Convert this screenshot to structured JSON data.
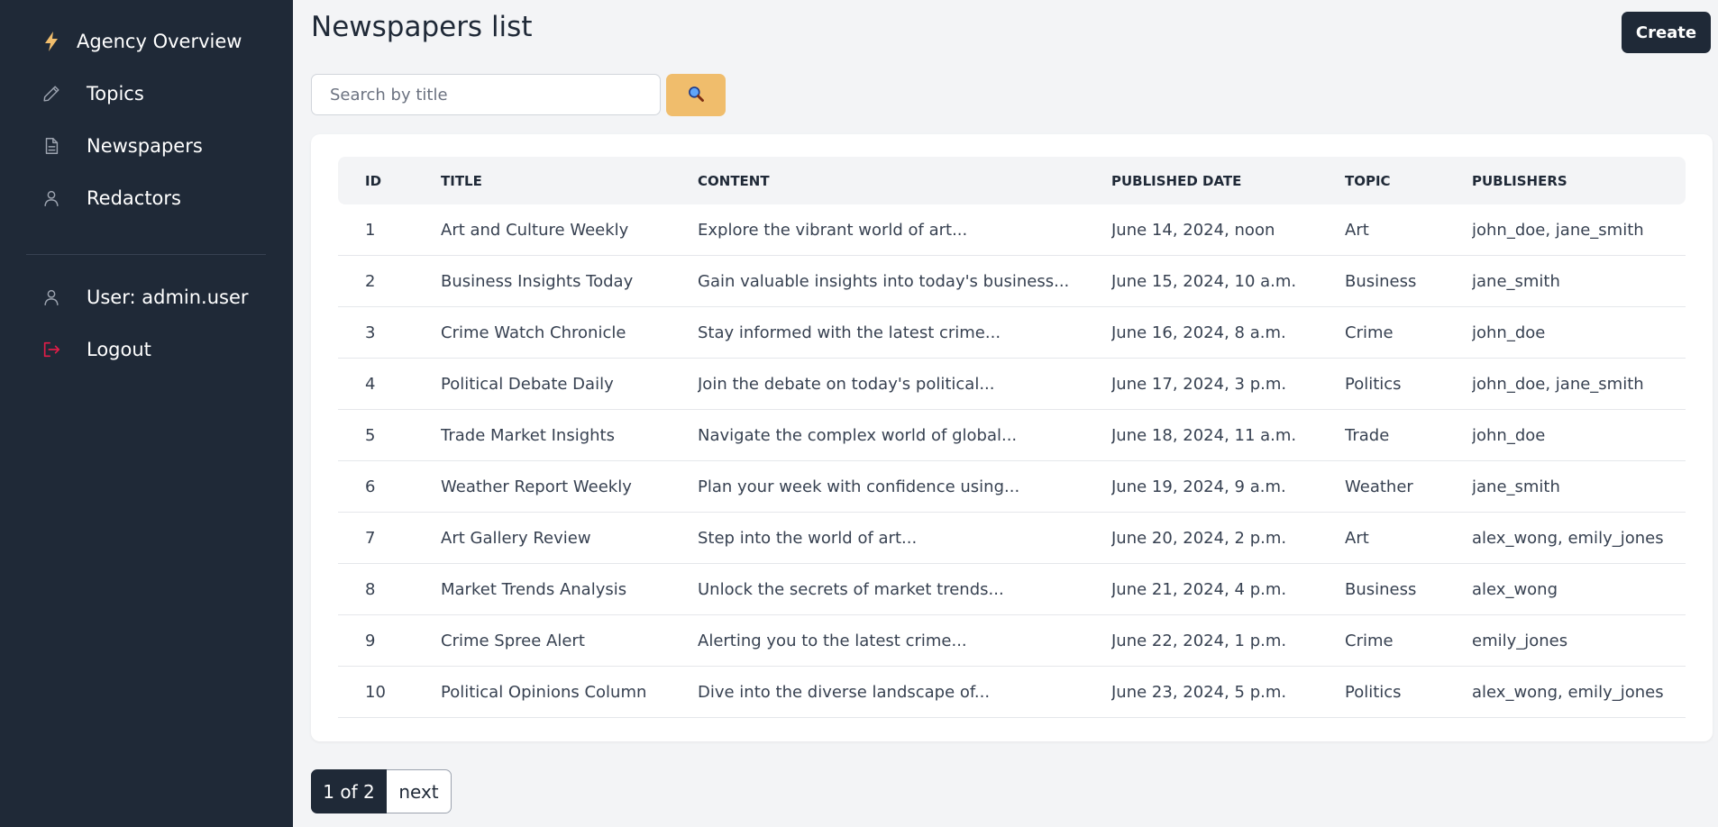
{
  "sidebar": {
    "items": [
      {
        "label": "Agency Overview",
        "icon": "lightning-icon"
      },
      {
        "label": "Topics",
        "icon": "pencil-icon"
      },
      {
        "label": "Newspapers",
        "icon": "document-icon"
      },
      {
        "label": "Redactors",
        "icon": "user-icon"
      },
      {
        "label": "User: admin.user",
        "icon": "user-icon"
      },
      {
        "label": "Logout",
        "icon": "logout-icon"
      }
    ]
  },
  "header": {
    "title": "Newspapers list",
    "create_label": "Create"
  },
  "search": {
    "placeholder": "Search by title",
    "value": "",
    "button_icon": "magnifier-icon"
  },
  "table": {
    "columns": [
      "ID",
      "TITLE",
      "CONTENT",
      "PUBLISHED DATE",
      "TOPIC",
      "PUBLISHERS"
    ],
    "rows": [
      {
        "id": "1",
        "title": "Art and Culture Weekly",
        "content": "Explore the vibrant world of art...",
        "date": "June 14, 2024, noon",
        "topic": "Art",
        "publishers": "john_doe, jane_smith"
      },
      {
        "id": "2",
        "title": "Business Insights Today",
        "content": "Gain valuable insights into today's business...",
        "date": "June 15, 2024, 10 a.m.",
        "topic": "Business",
        "publishers": "jane_smith"
      },
      {
        "id": "3",
        "title": "Crime Watch Chronicle",
        "content": "Stay informed with the latest crime...",
        "date": "June 16, 2024, 8 a.m.",
        "topic": "Crime",
        "publishers": "john_doe"
      },
      {
        "id": "4",
        "title": "Political Debate Daily",
        "content": "Join the debate on today's political...",
        "date": "June 17, 2024, 3 p.m.",
        "topic": "Politics",
        "publishers": "john_doe, jane_smith"
      },
      {
        "id": "5",
        "title": "Trade Market Insights",
        "content": "Navigate the complex world of global...",
        "date": "June 18, 2024, 11 a.m.",
        "topic": "Trade",
        "publishers": "john_doe"
      },
      {
        "id": "6",
        "title": "Weather Report Weekly",
        "content": "Plan your week with confidence using...",
        "date": "June 19, 2024, 9 a.m.",
        "topic": "Weather",
        "publishers": "jane_smith"
      },
      {
        "id": "7",
        "title": "Art Gallery Review",
        "content": "Step into the world of art...",
        "date": "June 20, 2024, 2 p.m.",
        "topic": "Art",
        "publishers": "alex_wong, emily_jones"
      },
      {
        "id": "8",
        "title": "Market Trends Analysis",
        "content": "Unlock the secrets of market trends...",
        "date": "June 21, 2024, 4 p.m.",
        "topic": "Business",
        "publishers": "alex_wong"
      },
      {
        "id": "9",
        "title": "Crime Spree Alert",
        "content": "Alerting you to the latest crime...",
        "date": "June 22, 2024, 1 p.m.",
        "topic": "Crime",
        "publishers": "emily_jones"
      },
      {
        "id": "10",
        "title": "Political Opinions Column",
        "content": "Dive into the diverse landscape of...",
        "date": "June 23, 2024, 5 p.m.",
        "topic": "Politics",
        "publishers": "alex_wong, emily_jones"
      }
    ]
  },
  "pagination": {
    "current": "1 of 2",
    "next_label": "next"
  },
  "colors": {
    "sidebar_bg": "#1f2937",
    "accent_orange": "#f0bd6c",
    "lightning": "#f0bd6c",
    "logout_red": "#e11d48"
  }
}
